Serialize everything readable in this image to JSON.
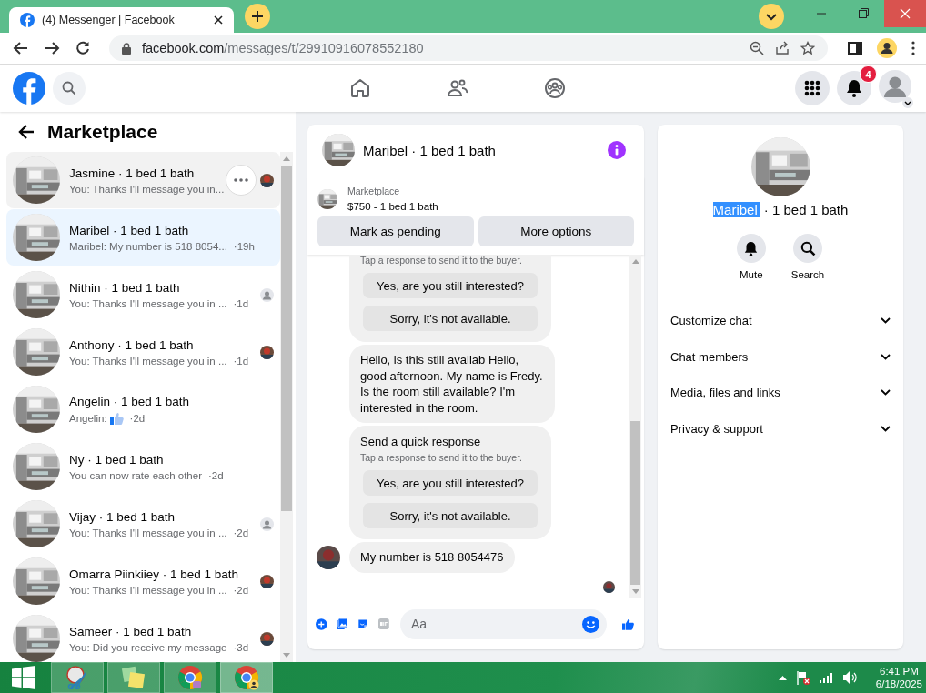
{
  "browser": {
    "tab_title": "(4) Messenger | Facebook",
    "url_host": "facebook.com",
    "url_path": "/messages/t/29910916078552180"
  },
  "header": {
    "nav": [
      {
        "kind": "home"
      },
      {
        "kind": "friends"
      },
      {
        "kind": "groups"
      }
    ],
    "notification_count": "4"
  },
  "inbox": {
    "title": "Marketplace",
    "conversations": [
      {
        "name": "Jasmine · 1 bed 1 bath",
        "preview": "You: Thanks I'll message you in...",
        "preview_like": false,
        "selected": false,
        "hovered": true
      },
      {
        "name": "Maribel · 1 bed 1 bath",
        "preview": "Maribel: My number is 518 8054...",
        "time": "·19h",
        "preview_like": false,
        "selected": true,
        "hovered": false
      },
      {
        "name": "Nithin · 1 bed 1 bath",
        "preview": "You: Thanks I'll message you in ...",
        "time": "·1d",
        "preview_like": false,
        "selected": false,
        "hovered": false,
        "receipt": {
          "kind": "person"
        }
      },
      {
        "name": "Anthony · 1 bed 1 bath",
        "preview": "You: Thanks I'll message you in ...",
        "time": "·1d",
        "preview_like": false,
        "selected": false,
        "hovered": false
      },
      {
        "name": "Angelin · 1 bed 1 bath",
        "preview": "Angelin:",
        "preview_like": true,
        "time": "·2d",
        "selected": false,
        "hovered": false
      },
      {
        "name": "Ny · 1 bed 1 bath",
        "preview": "You can now rate each other",
        "time": "·2d",
        "preview_like": false,
        "selected": false,
        "hovered": false
      },
      {
        "name": "Vijay · 1 bed 1 bath",
        "preview": "You: Thanks I'll message you in ...",
        "time": "·2d",
        "preview_like": false,
        "selected": false,
        "hovered": false,
        "receipt": {
          "kind": "person"
        }
      },
      {
        "name": "Omarra Piinkiiey · 1 bed 1 bath",
        "preview": "You: Thanks I'll message you in ...",
        "time": "·2d",
        "preview_like": false,
        "selected": false,
        "hovered": false
      },
      {
        "name": "Sameer · 1 bed 1 bath",
        "preview": "You: Did you receive my message",
        "time": "·3d",
        "preview_like": false,
        "selected": false,
        "hovered": false
      }
    ]
  },
  "chat": {
    "title": "Maribel · 1 bed 1 bath",
    "listing": {
      "label": "Marketplace",
      "title": "$750 - 1 bed 1 bath"
    },
    "actions": [
      "Mark as pending",
      "More options"
    ],
    "messages": [
      {
        "kind": "quick_response",
        "hint": "Tap a response to send it to the buyer.",
        "options": [
          "Yes, are you still interested?",
          "Sorry, it's not available."
        ]
      },
      {
        "kind": "text",
        "text": "Hello, is this still availab Hello, good afternoon. My name is Fredy. Is the room still available? I'm interested in the room.",
        "avatar": false
      },
      {
        "kind": "quick_response",
        "title": "Send a quick response",
        "hint": "Tap a response to send it to the buyer.",
        "options": [
          "Yes, are you still interested?",
          "Sorry, it's not available."
        ]
      },
      {
        "kind": "text",
        "text": "My number is 518 8054476",
        "avatar": true
      }
    ],
    "seen": true,
    "composer": {
      "placeholder": "Aa"
    }
  },
  "details": {
    "name": "Maribel",
    "name_selected": true,
    "subtitle": "· 1 bed 1 bath",
    "actions": [
      {
        "kind": "mute",
        "label": "Mute"
      },
      {
        "kind": "search",
        "label": "Search"
      }
    ],
    "sections": [
      {
        "label": "Customize chat",
        "expanded": false
      },
      {
        "label": "Chat members",
        "expanded": false
      },
      {
        "label": "Media, files and links",
        "expanded": false
      },
      {
        "label": "Privacy & support",
        "expanded": false
      }
    ]
  },
  "taskbar": {
    "apps": [
      {
        "kind": "snipping",
        "active": false
      },
      {
        "kind": "sticky_notes",
        "active": false
      },
      {
        "kind": "chrome",
        "active": false
      },
      {
        "kind": "chrome_profile",
        "active": true
      }
    ],
    "time": "6:41 PM",
    "date": "6/18/2025"
  }
}
